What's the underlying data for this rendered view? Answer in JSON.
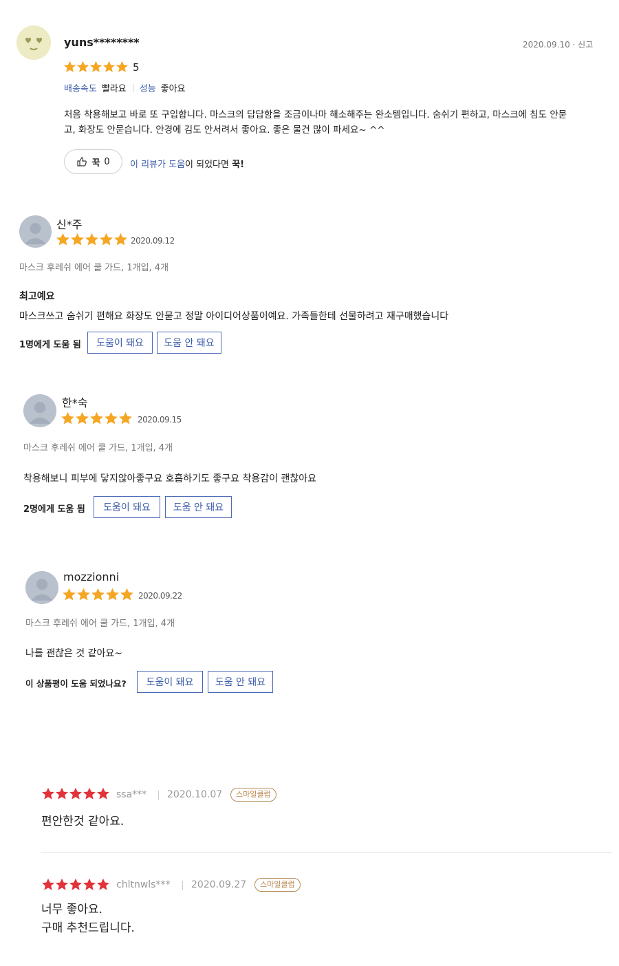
{
  "review1": {
    "user": "yuns********",
    "date_action": "2020.09.10 · 신고",
    "rating": "5",
    "attr1_label": "배송속도",
    "attr1_value": "빨라요",
    "attr2_label": "성능",
    "attr2_value": "좋아요",
    "text_line1": "처음 착용해보고 바로 또 구입합니다. 마스크의 답답함을 조금이나마 해소해주는 완소템입니다. 숨쉬기 편하고, 마스크에 침도 안묻",
    "text_line2": "고, 화장도 안묻습니다. 안경에 김도 안서려서 좋아요. 좋은 물건 많이 파세요~ ^^",
    "like_label": "꾹",
    "like_count": "0",
    "helpful_prefix": "이 리뷰가 도움",
    "helpful_mid": "이 되었다면 ",
    "helpful_strong": "꾹!"
  },
  "review2": {
    "user": "신*주",
    "date": "2020.09.12",
    "option": "마스크 후레쉬 에어 쿨 가드, 1개입, 4개",
    "headline": "최고예요",
    "text": "마스크쓰고 숨쉬기 편해요 화장도 안묻고 정말 아이디어상품이예요. 가족들한테 선물하려고 재구매했습니다",
    "helpful_count": "1명에게 도움 됨",
    "yes_label": "도움이 돼요",
    "no_label": "도움 안 돼요"
  },
  "review3": {
    "user": "한*숙",
    "date": "2020.09.15",
    "option": "마스크 후레쉬 에어 쿨 가드, 1개입, 4개",
    "text": "착용해보니 피부에 닿지않아좋구요 호흡하기도 좋구요 착용감이 괜찮아요",
    "helpful_count": "2명에게 도움 됨",
    "yes_label": "도움이 돼요",
    "no_label": "도움 안 돼요"
  },
  "review4": {
    "user": "mozzionni",
    "date": "2020.09.22",
    "option": "마스크 후레쉬 에어 쿨 가드, 1개입, 4개",
    "text": "나를 괜찮은 것 같아요~",
    "question": "이 상품평이 도움 되었나요?",
    "yes_label": "도움이 돼요",
    "no_label": "도움 안 돼요"
  },
  "review5": {
    "user": "ssa***",
    "date": "2020.10.07",
    "badge": "스마일클럽",
    "text": "편안한것 같아요."
  },
  "review6": {
    "user": "chltnwls***",
    "date": "2020.09.27",
    "badge": "스마일클럽",
    "text_line1": "너무 좋아요.",
    "text_line2": "구매 추천드립니다."
  },
  "colors": {
    "star_orange": "#f5a623",
    "star_red": "#e2333b",
    "link_blue": "#3d5caa"
  },
  "icons": [
    "emoji-avatar-icon",
    "user-avatar-icon",
    "star-icon",
    "thumb-icon"
  ]
}
